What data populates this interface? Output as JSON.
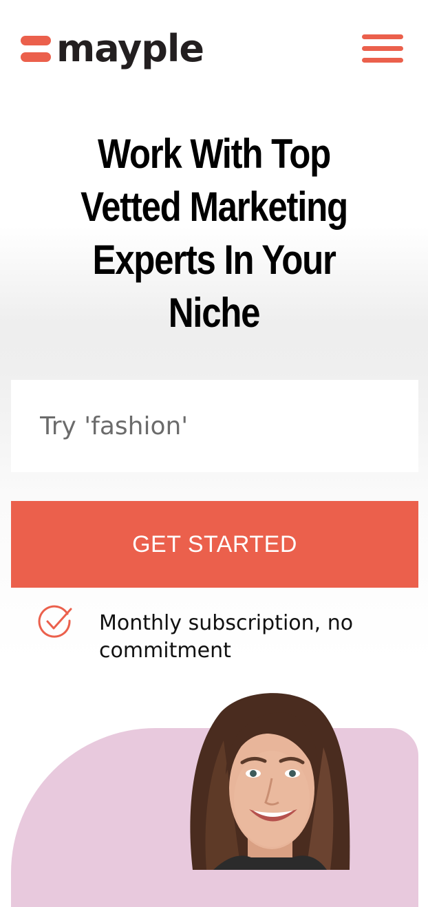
{
  "header": {
    "logo_text": "mayple",
    "menu_icon": "hamburger-menu-icon"
  },
  "hero": {
    "headline_lines": [
      "Work With Top",
      "Vetted Marketing",
      "Experts In Your",
      "Niche"
    ]
  },
  "search": {
    "placeholder": "Try 'fashion'",
    "value": ""
  },
  "cta": {
    "label": "GET STARTED"
  },
  "features": [
    {
      "icon": "check-circle-icon",
      "text": "Monthly subscription, no commitment"
    }
  ],
  "colors": {
    "brand": "#eb604c",
    "hero_background": "#e8c9dd",
    "text": "#000000"
  }
}
